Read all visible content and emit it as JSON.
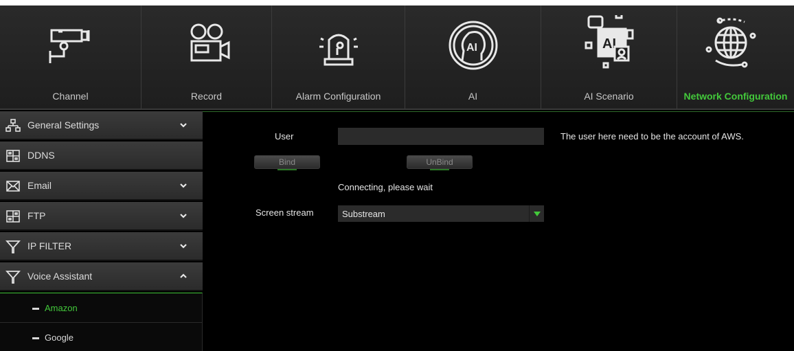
{
  "top_tabs": [
    {
      "label": "Channel",
      "icon": "camera-icon"
    },
    {
      "label": "Record",
      "icon": "video-recorder-icon"
    },
    {
      "label": "Alarm Configuration",
      "icon": "alarm-light-icon"
    },
    {
      "label": "AI",
      "icon": "ai-head-icon"
    },
    {
      "label": "AI Scenario",
      "icon": "ai-scenario-icon"
    },
    {
      "label": "Network Configuration",
      "icon": "globe-network-icon",
      "active": true
    }
  ],
  "sidebar": {
    "items": [
      {
        "label": "General Settings",
        "icon": "network-icon",
        "chevron": "down"
      },
      {
        "label": "DDNS",
        "icon": "ddns-icon"
      },
      {
        "label": "Email",
        "icon": "envelope-icon",
        "chevron": "down"
      },
      {
        "label": "FTP",
        "icon": "ftp-icon",
        "chevron": "down"
      },
      {
        "label": "IP FILTER",
        "icon": "filter-icon",
        "chevron": "down"
      },
      {
        "label": "Voice Assistant",
        "icon": "filter-icon",
        "chevron": "up"
      }
    ],
    "sub_items": [
      {
        "label": "Amazon",
        "active": true
      },
      {
        "label": "Google"
      }
    ]
  },
  "form": {
    "user_label": "User",
    "user_value": "",
    "bind_label": "Bind",
    "unbind_label": "UnBind",
    "status_text": "Connecting, please wait",
    "stream_label": "Screen stream",
    "stream_value": "Substream",
    "hint_text": "The user here need to be the account of AWS."
  },
  "colors": {
    "accent": "#43c93b",
    "background": "#000000",
    "panel": "#2b2b2b"
  }
}
